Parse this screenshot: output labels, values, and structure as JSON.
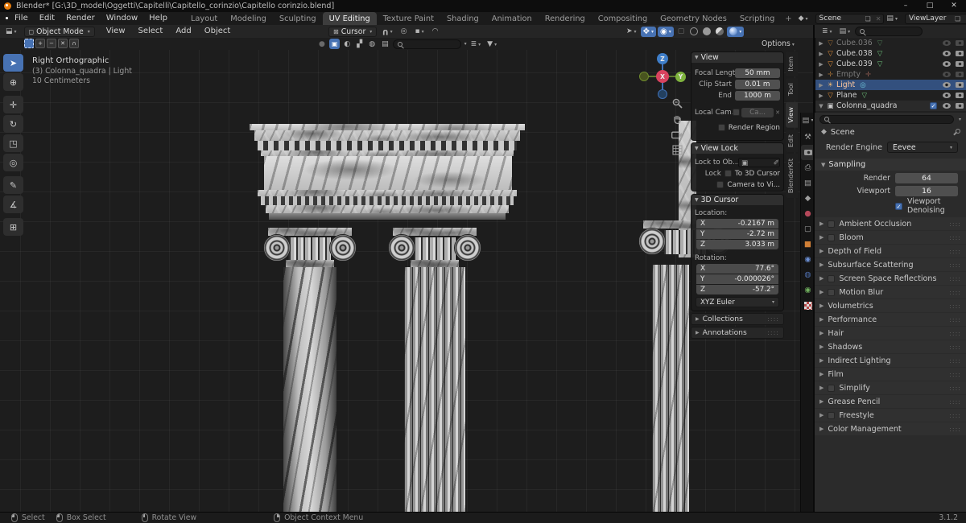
{
  "window": {
    "title": "Blender*  [G:\\3D_model\\Oggetti\\Capitelli\\Capitello_corinzio\\Capitello corinzio.blend]",
    "controls": {
      "minimize": "–",
      "maximize": "□",
      "close": "✕"
    }
  },
  "topbar": {
    "menus": [
      "File",
      "Edit",
      "Render",
      "Window",
      "Help"
    ],
    "workspaces": [
      "Layout",
      "Modeling",
      "Sculpting",
      "UV Editing",
      "Texture Paint",
      "Shading",
      "Animation",
      "Rendering",
      "Compositing",
      "Geometry Nodes",
      "Scripting"
    ],
    "add_tab": "+",
    "scene": "Scene",
    "view_layer": "ViewLayer"
  },
  "vheader": {
    "mode": "Object Mode",
    "menus": [
      "View",
      "Select",
      "Add",
      "Object"
    ],
    "pivot": "Cursor",
    "options": "Options"
  },
  "viewport": {
    "overlay1": "Right Orthographic",
    "overlay2": "(3) Colonna_quadra | Light",
    "overlay3": "10 Centimeters",
    "gizmo": {
      "x": "X",
      "y": "Y",
      "z": "Z"
    }
  },
  "npanel": {
    "tabs": [
      "Item",
      "Tool",
      "View",
      "Edit",
      "BlenderKit"
    ],
    "view": {
      "title": "View",
      "focal_label": "Focal Lengt",
      "focal": "50 mm",
      "clip_label": "Clip Start",
      "clip": "0.01 m",
      "end_label": "End",
      "end": "1000 m",
      "localcam_label": "Local Cam...",
      "localcam": "Ca...",
      "render_region": "Render Region"
    },
    "view_lock": {
      "title": "View Lock",
      "lockto_label": "Lock to Ob...",
      "lock_label": "Lock",
      "to_cursor": "To 3D Cursor",
      "cam_to_view": "Camera to Vi..."
    },
    "cursor3d": {
      "title": "3D Cursor",
      "location_label": "Location:",
      "loc": [
        {
          "axis": "X",
          "value": "-0.2167 m"
        },
        {
          "axis": "Y",
          "value": "-2.72 m"
        },
        {
          "axis": "Z",
          "value": "3.033 m"
        }
      ],
      "rotation_label": "Rotation:",
      "rot": [
        {
          "axis": "X",
          "value": "77.6°"
        },
        {
          "axis": "Y",
          "value": "-0.000026°"
        },
        {
          "axis": "Z",
          "value": "-57.2°"
        }
      ],
      "euler": "XYZ Euler"
    },
    "collections": "Collections",
    "annotations": "Annotations"
  },
  "outliner": {
    "rows": [
      {
        "name": "Cube.036"
      },
      {
        "name": "Cube.038"
      },
      {
        "name": "Cube.039"
      },
      {
        "name": "Empty"
      },
      {
        "name": "Light"
      },
      {
        "name": "Plane"
      }
    ],
    "collection": "Colonna_quadra"
  },
  "props": {
    "breadcrumb": "Scene",
    "engine_label": "Render Engine",
    "engine": "Eevee",
    "sampling": {
      "title": "Sampling",
      "render_label": "Render",
      "render": "64",
      "viewport_label": "Viewport",
      "viewport": "16",
      "denoising": "Viewport Denoising"
    },
    "panels": [
      {
        "label": "Ambient Occlusion"
      },
      {
        "label": "Bloom"
      },
      {
        "label": "Depth of Field"
      },
      {
        "label": "Subsurface Scattering"
      },
      {
        "label": "Screen Space Reflections"
      },
      {
        "label": "Motion Blur"
      },
      {
        "label": "Volumetrics"
      },
      {
        "label": "Performance"
      },
      {
        "label": "Hair"
      },
      {
        "label": "Shadows"
      },
      {
        "label": "Indirect Lighting"
      },
      {
        "label": "Film"
      },
      {
        "label": "Simplify"
      },
      {
        "label": "Grease Pencil"
      },
      {
        "label": "Freestyle"
      },
      {
        "label": "Color Management"
      }
    ]
  },
  "status": {
    "items": [
      "Select",
      "Box Select",
      "Rotate View",
      "Object Context Menu"
    ],
    "version": "3.1.2"
  }
}
